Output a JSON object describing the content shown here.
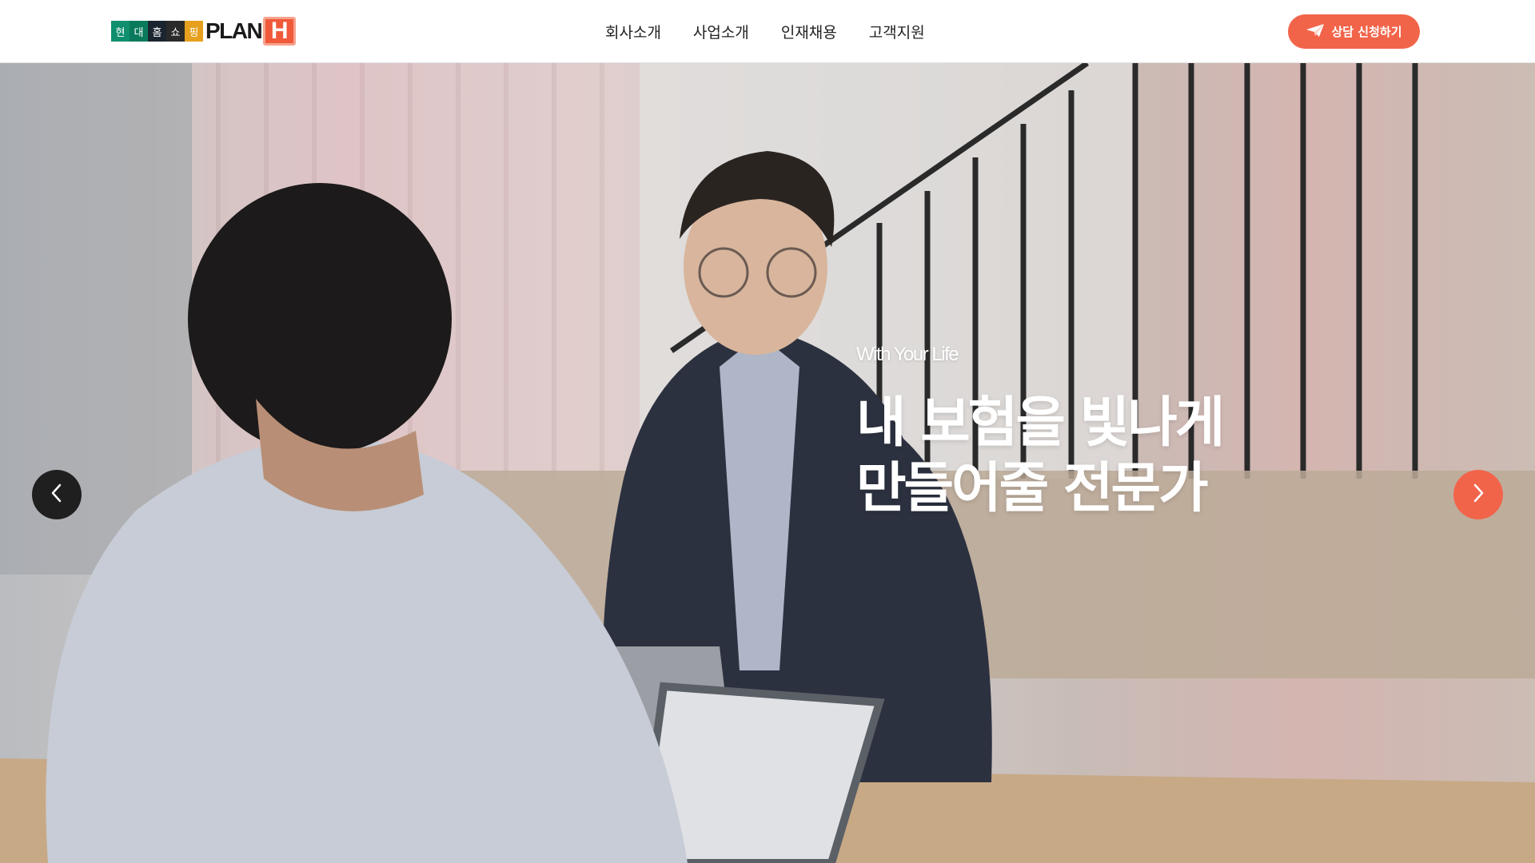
{
  "header": {
    "logo": {
      "blocks": [
        {
          "char": "현",
          "color": "#0f8f6e"
        },
        {
          "char": "대",
          "color": "#0a7a5c"
        },
        {
          "char": "홈",
          "color": "#1b2530"
        },
        {
          "char": "쇼",
          "color": "#2a2a2a"
        },
        {
          "char": "핑",
          "color": "#e6a01e"
        }
      ],
      "plan_text": "PLAN",
      "h_text": "H"
    },
    "nav": [
      "회사소개",
      "사업소개",
      "인재채용",
      "고객지원"
    ],
    "consult_button": "상담 신청하기",
    "accent_color": "#f2644a"
  },
  "hero": {
    "subtitle": "With Your Life",
    "title_lines": [
      "내 보험을 빛나게",
      "만들어줄 전문가"
    ]
  },
  "carousel": {
    "prev_icon": "chevron-left-icon",
    "next_icon": "chevron-right-icon"
  }
}
